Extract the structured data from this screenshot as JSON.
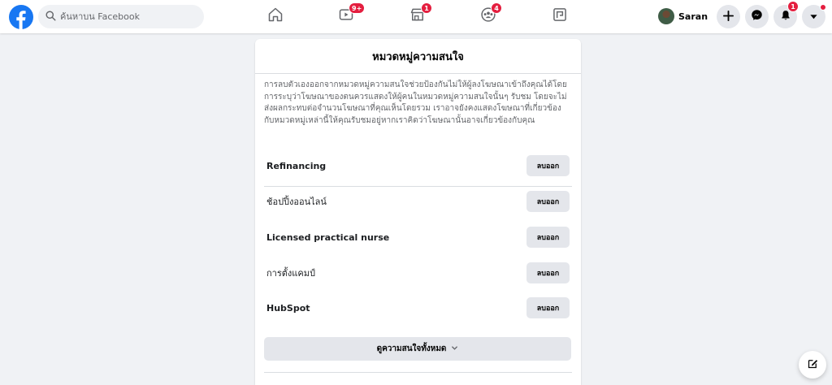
{
  "header": {
    "search_placeholder": "ค้นหาบน Facebook",
    "nav": {
      "watch_badge": "9+",
      "marketplace_badge": "1",
      "groups_badge": "4"
    },
    "profile_name": "Saran",
    "notifications_badge": "1",
    "icons": [
      "facebook-logo-icon",
      "search-icon",
      "home-icon",
      "watch-icon",
      "marketplace-icon",
      "groups-icon",
      "gaming-icon",
      "plus-icon",
      "messenger-icon",
      "bell-icon",
      "caret-down-icon",
      "compose-icon"
    ]
  },
  "dialog": {
    "title": "หมวดหมู่ความสนใจ",
    "description": "การลบตัวเองออกจากหมวดหมู่ความสนใจช่วยป้องกันไม่ให้ผู้ลงโฆษณาเข้าถึงคุณได้โดยการระบุว่าโฆษณาของตนควรแสดงให้ผู้คนในหมวดหมู่ความสนใจนั้นๆ รับชม โดยจะไม่ส่งผลกระทบต่อจำนวนโฆษณาที่คุณเห็นโดยรวม เราอาจยังคงแสดงโฆษณาที่เกี่ยวข้องกับหมวดหมู่เหล่านี้ให้คุณรับชมอยู่หากเราคิดว่าโฆษณานั้นอาจเกี่ยวข้องกับคุณ",
    "items": [
      {
        "label": "Refinancing",
        "button": "ลบออก"
      },
      {
        "label": "ช้อปปิ้งออนไลน์",
        "button": "ลบออก"
      },
      {
        "label": "Licensed practical nurse",
        "button": "ลบออก"
      },
      {
        "label": "การตั้งแคมป์",
        "button": "ลบออก"
      },
      {
        "label": "HubSpot",
        "button": "ลบออก"
      }
    ],
    "see_all_label": "ดูความสนใจทั้งหมด"
  },
  "colors": {
    "brand": "#1877f2",
    "badge": "#e41e3f",
    "background": "#f0f2f5",
    "button_gray": "#e4e6eb"
  }
}
